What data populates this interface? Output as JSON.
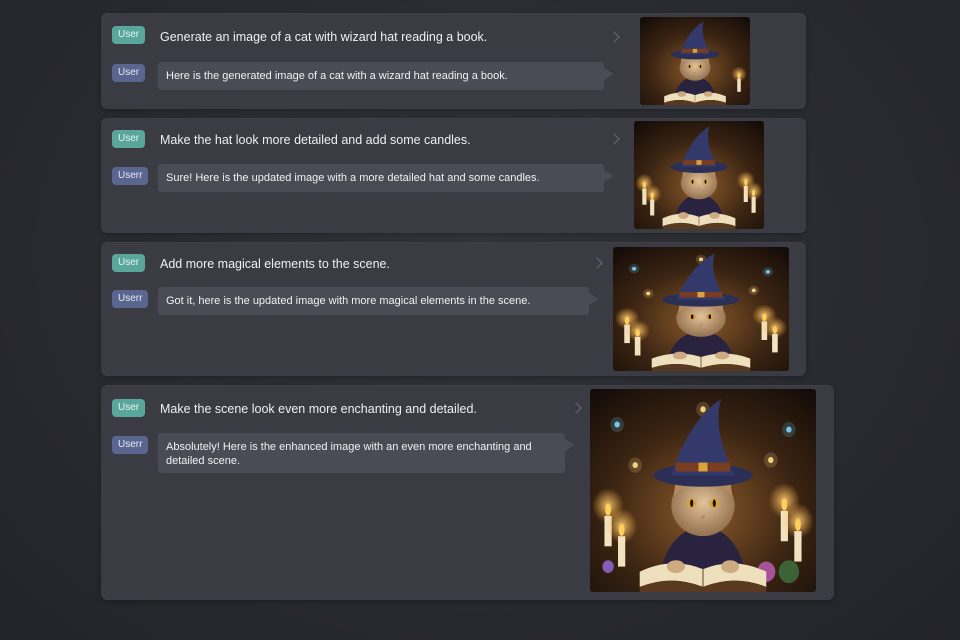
{
  "badge_user": "User",
  "badge_reply_short": "User",
  "badge_reply_long": "Userr",
  "turns": [
    {
      "prompt": "Generate an image of a cat with wizard hat reading a book.",
      "response": "Here is the generated image of a cat with a wizard hat reading a book.",
      "reply_badge": "User",
      "image": "cat-wizard-image"
    },
    {
      "prompt": "Make the hat look more detailed and add some candles.",
      "response": "Sure! Here is the updated image with a more detailed hat and some candles.",
      "reply_badge": "Userr",
      "image": "cat-wizard-candles-image"
    },
    {
      "prompt": "Add more magical elements to the scene.",
      "response": "Got it, here is the updated image with more magical elements in the scene.",
      "reply_badge": "Userr",
      "image": "cat-wizard-magical-image"
    },
    {
      "prompt": "Make the scene look even more enchanting and detailed.",
      "response": "Absolutely! Here is the enhanced image with an even more enchanting and detailed scene.",
      "reply_badge": "Userr",
      "image": "cat-wizard-enchanting-image"
    }
  ],
  "colors": {
    "user_badge": "#58a79a",
    "reply_badge": "#5a6690",
    "card": "#3a3b43",
    "bubble": "#4a4b54"
  }
}
